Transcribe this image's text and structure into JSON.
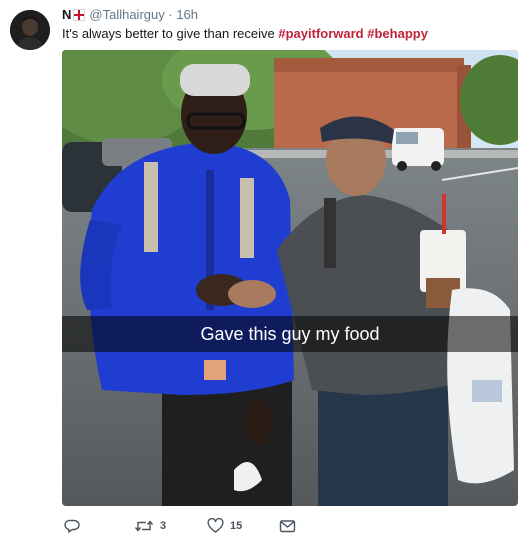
{
  "tweet": {
    "display_name": "N",
    "handle": "@Tallhairguy",
    "separator": "·",
    "timestamp": "16h",
    "text_plain": "It's always better to give than receive ",
    "hashtags": [
      "#payitforward",
      "#behappy"
    ],
    "media_caption": "Gave this guy my food"
  },
  "actions": {
    "reply_icon": "reply-icon",
    "retweet_icon": "retweet-icon",
    "retweet_count": "3",
    "like_icon": "heart-icon",
    "like_count": "15",
    "dm_icon": "envelope-icon"
  },
  "colors": {
    "hashtag": "#c0223b",
    "muted": "#657786",
    "action_icon": "#4a5560"
  }
}
